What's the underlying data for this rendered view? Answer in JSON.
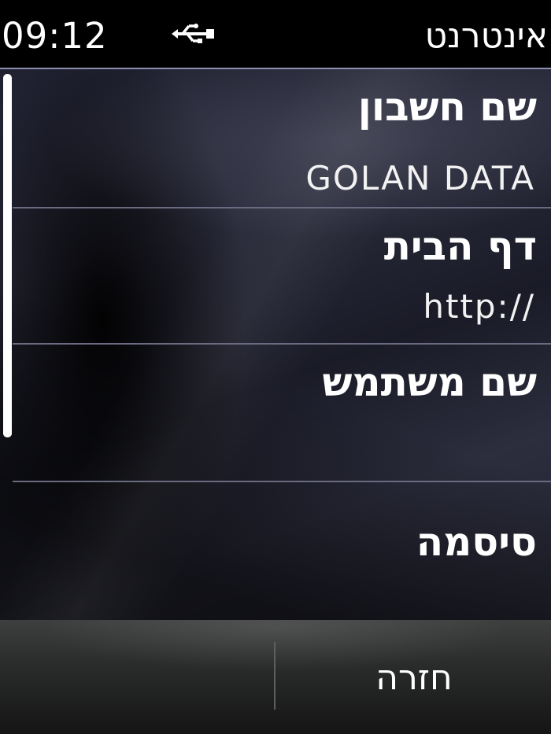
{
  "status_bar": {
    "time": "09:12",
    "usb_icon": "usb-connection-icon",
    "title": "אינטרנט"
  },
  "settings": {
    "account_name": {
      "label": "שם חשבון",
      "value": "GOLAN DATA"
    },
    "homepage": {
      "label": "דף הבית",
      "value": "http://"
    },
    "username": {
      "label": "שם משתמש",
      "value": ""
    },
    "password": {
      "label": "סיסמה",
      "value": ""
    }
  },
  "softkeys": {
    "left": "",
    "right": "חזרה"
  },
  "colors": {
    "background": "#000000",
    "text": "#ffffff",
    "separator": "#6a6b80",
    "status_divider": "#8d8fb0"
  }
}
